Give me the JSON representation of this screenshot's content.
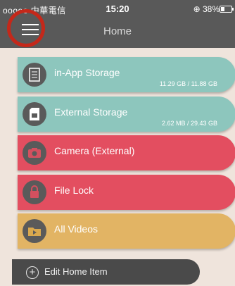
{
  "status": {
    "signal": "ooooo 中華電信 ",
    "time": "15:20",
    "battery_text": "⊕ 38%",
    "battery_level": 0.38
  },
  "header": {
    "title": "Home"
  },
  "items": [
    {
      "label": "in-App Storage",
      "size": "11.29 GB / 11.88 GB",
      "color": "#8dc6bd",
      "icon": "document-icon"
    },
    {
      "label": "External Storage",
      "size": "2.62 MB / 29.43 GB",
      "color": "#8dc6bd",
      "icon": "sd-card-icon"
    },
    {
      "label": "Camera (External)",
      "size": "",
      "color": "#e34e60",
      "icon": "camera-icon"
    },
    {
      "label": "File Lock",
      "size": "",
      "color": "#e34e60",
      "icon": "lock-icon"
    },
    {
      "label": "All Videos",
      "size": "",
      "color": "#e2b464",
      "icon": "video-folder-icon"
    }
  ],
  "footer": {
    "edit_label": "Edit Home Item"
  }
}
